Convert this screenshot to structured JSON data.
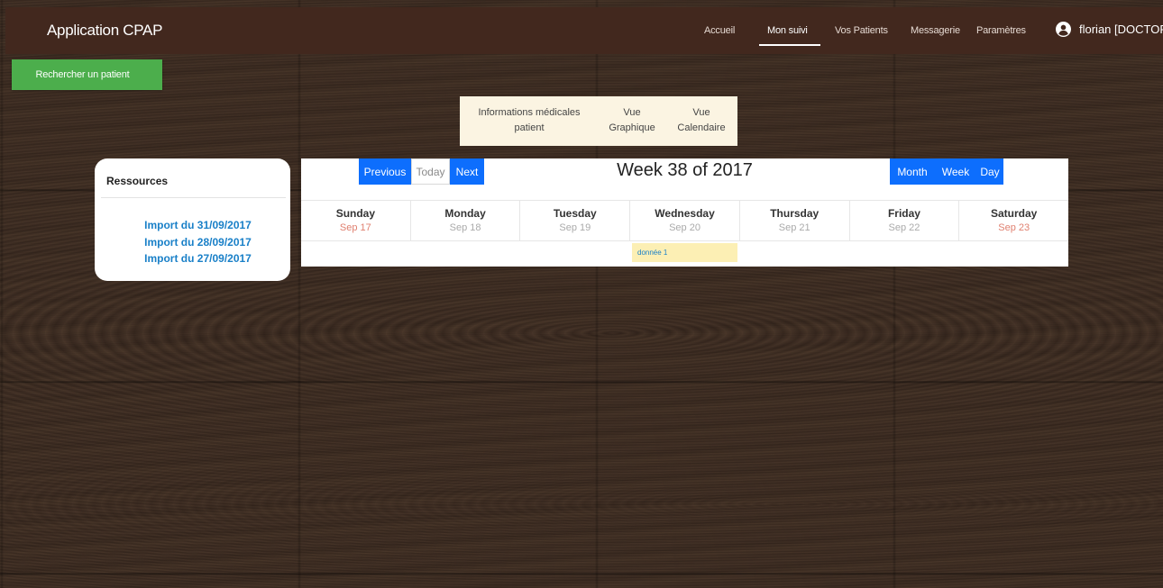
{
  "navbar": {
    "brand": "Application CPAP",
    "links": [
      {
        "label": "Accueil"
      },
      {
        "label": "Mon suivi",
        "active": true
      },
      {
        "label": "Vos Patients"
      },
      {
        "label": "Messagerie"
      },
      {
        "label": "Paramètres"
      }
    ],
    "user": "florian [DOCTOR]"
  },
  "search_button": "Rechercher un patient",
  "tabs": [
    {
      "line1": "Informations médicales",
      "line2": "patient"
    },
    {
      "line1": "Vue",
      "line2": "Graphique"
    },
    {
      "line1": "Vue",
      "line2": "Calendaire"
    }
  ],
  "resources": {
    "title": "Ressources",
    "items": [
      "Import du 31/09/2017",
      "Import du 28/09/2017",
      "Import du 27/09/2017"
    ]
  },
  "calendar": {
    "nav_buttons": {
      "previous": "Previous",
      "today": "Today",
      "next": "Next"
    },
    "title": "Week 38 of 2017",
    "view_buttons": {
      "month": "Month",
      "week": "Week",
      "day": "Day"
    },
    "days": [
      {
        "name": "Sunday",
        "date": "Sep 17",
        "weekend": true
      },
      {
        "name": "Monday",
        "date": "Sep 18"
      },
      {
        "name": "Tuesday",
        "date": "Sep 19"
      },
      {
        "name": "Wednesday",
        "date": "Sep 20"
      },
      {
        "name": "Thursday",
        "date": "Sep 21"
      },
      {
        "name": "Friday",
        "date": "Sep 22"
      },
      {
        "name": "Saturday",
        "date": "Sep 23",
        "weekend": true
      }
    ],
    "event": {
      "label": "donnée 1",
      "day": "Wednesday"
    }
  },
  "colors": {
    "navbar": "#42281e",
    "search_button": "#4cae4c",
    "primary_button": "#0d6efd",
    "link": "#1a80c8",
    "event_bg": "#fcefb4",
    "tabs_bg": "#fbf4e2"
  }
}
